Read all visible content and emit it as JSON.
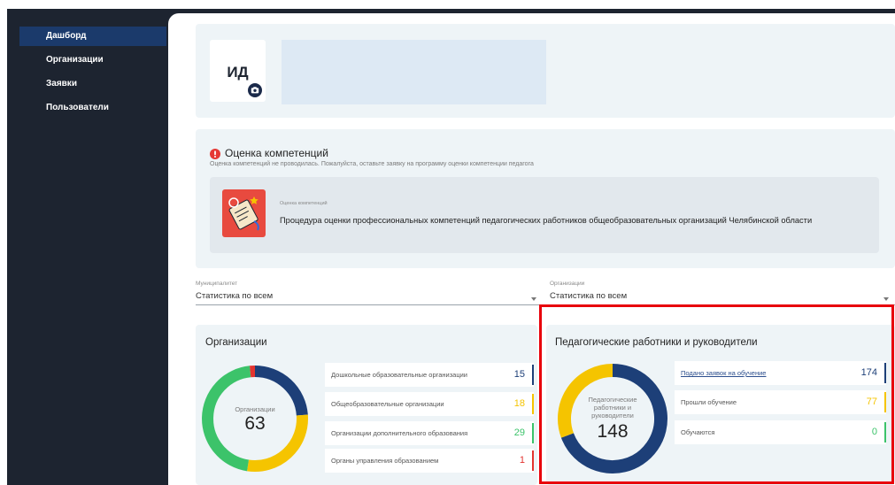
{
  "sidebar": {
    "items": [
      {
        "label": "Дашборд",
        "active": true
      },
      {
        "label": "Организации"
      },
      {
        "label": "Заявки"
      },
      {
        "label": "Пользователи"
      }
    ]
  },
  "profile": {
    "initials": "ИД",
    "badge_icon": "camera-icon"
  },
  "competency": {
    "alert_icon": "exclamation-circle-icon",
    "title": "Оценка компетенций",
    "subtitle": "Оценка компетенций не проводилась. Пожалуйста, оставьте заявку на программу оценки компетенции педагога",
    "program": {
      "label": "Оценка компетенций",
      "title": "Процедура оценки профессиональных компетенций педагогических работников общеобразовательных организаций Челябинской области"
    }
  },
  "filters": {
    "dropdown_icon": "chevron-down-icon",
    "municipality": {
      "label": "Муниципалитет",
      "value": "Статистика по всем"
    },
    "organization": {
      "label": "Организации",
      "value": "Статистика по всем"
    }
  },
  "organizations_widget": {
    "title": "Организации",
    "center_label": "Организации",
    "center_value": "63",
    "items": [
      {
        "label": "Дошкольные образовательные организации",
        "value": 15,
        "color": "#1d3f78"
      },
      {
        "label": "Общеобразовательные организации",
        "value": 18,
        "color": "#f5c400"
      },
      {
        "label": "Организации дополнительного образования",
        "value": 29,
        "color": "#3cc36a"
      },
      {
        "label": "Органы управления образованием",
        "value": 1,
        "color": "#e3342f"
      }
    ]
  },
  "teachers_widget": {
    "title": "Педагогические работники и руководители",
    "center_label": "Педагогические работники и руководители",
    "center_value": "148",
    "items": [
      {
        "label": "Подано заявок на обучение",
        "value": 174,
        "color": "#1d3f78"
      },
      {
        "label": "Прошли обучение",
        "value": 77,
        "color": "#f5c400"
      },
      {
        "label": "Обучаются",
        "value": 0,
        "color": "#3cc36a"
      }
    ]
  },
  "colors": {
    "highlight": "#e8000b"
  }
}
